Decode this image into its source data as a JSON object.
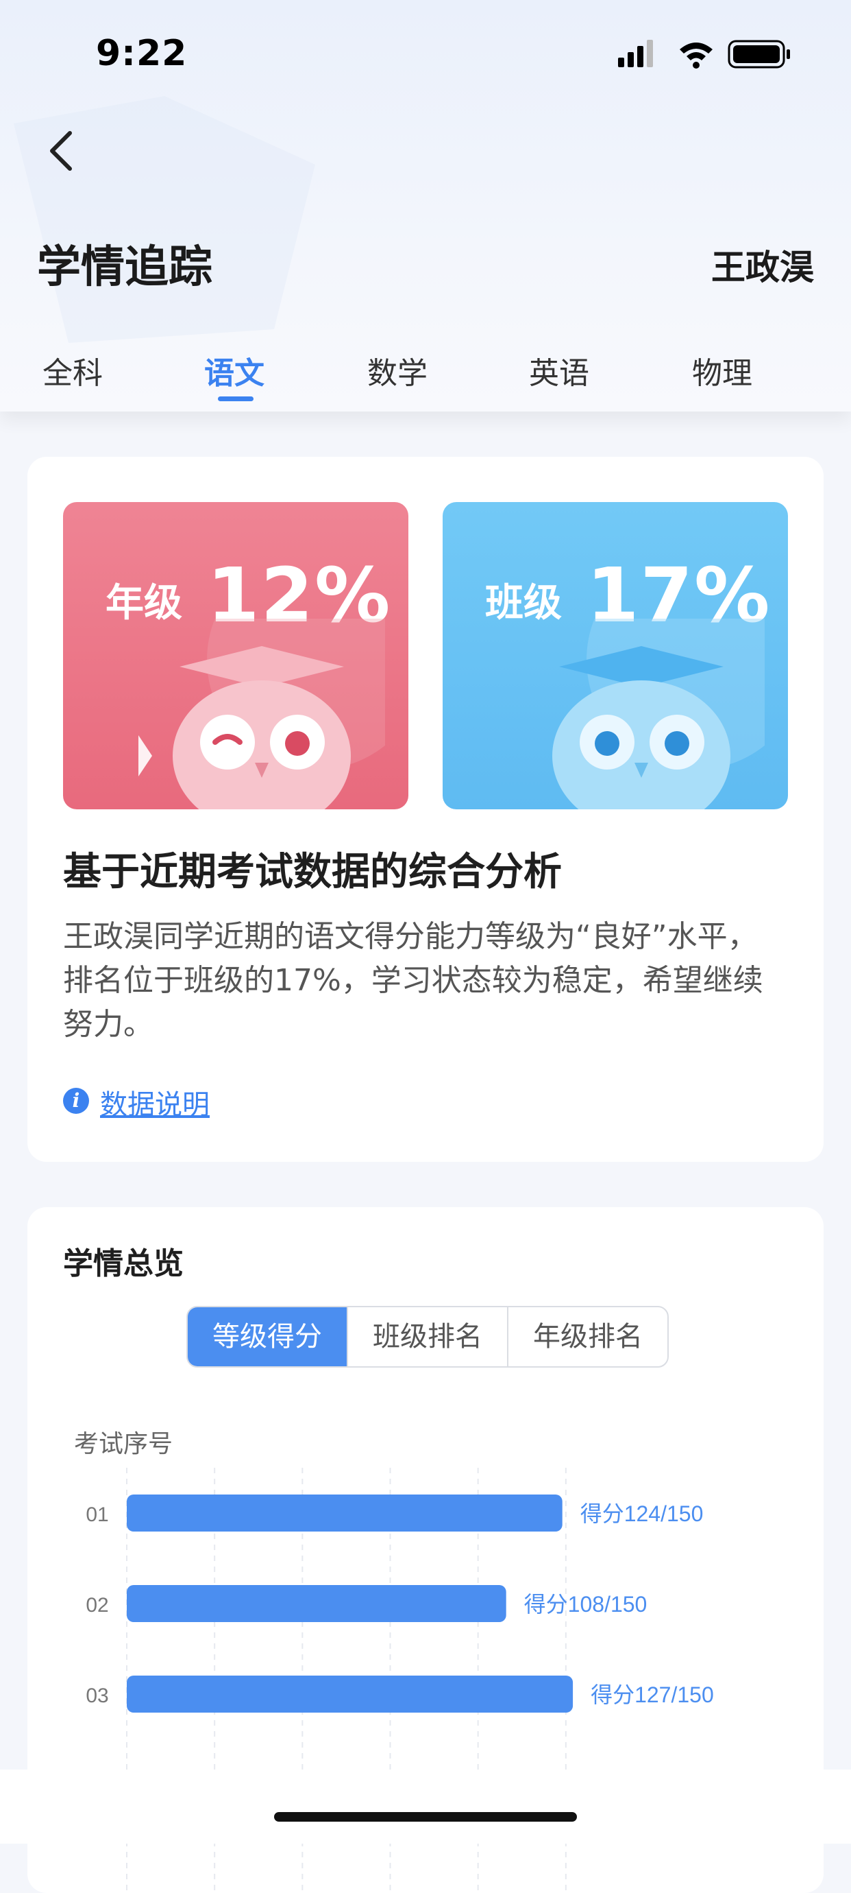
{
  "status_bar": {
    "time": "9:22"
  },
  "header": {
    "title": "学情追踪",
    "student_name": "王政淏"
  },
  "tabs": [
    {
      "label": "全科",
      "active": false
    },
    {
      "label": "语文",
      "active": true
    },
    {
      "label": "数学",
      "active": false
    },
    {
      "label": "英语",
      "active": false
    },
    {
      "label": "物理",
      "active": false
    }
  ],
  "summary": {
    "grade_rank": {
      "label": "年级",
      "value": "12%"
    },
    "class_rank": {
      "label": "班级",
      "value": "17%"
    },
    "analysis_title": "基于近期考试数据的综合分析",
    "analysis_text": "王政淏同学近期的语文得分能力等级为“良好”水平， 排名位于班级的17%，学习状态较为稳定，希望继续努力。",
    "info_link": "数据说明"
  },
  "overview": {
    "title": "学情总览",
    "segments": [
      "等级得分",
      "班级排名",
      "年级排名"
    ],
    "active_segment": 0,
    "y_axis_label": "考试序号"
  },
  "chart_data": {
    "type": "bar",
    "orientation": "horizontal",
    "categories": [
      "01",
      "02",
      "03"
    ],
    "values": [
      124,
      108,
      127
    ],
    "max": 150,
    "value_labels": [
      "得分124/150",
      "得分108/150",
      "得分127/150"
    ],
    "ylabel": "考试序号",
    "xlim": [
      0,
      150
    ],
    "grid": true,
    "color": "#4b8ef0"
  },
  "colors": {
    "accent": "#3b82f0",
    "grade_card": "#e86a7d",
    "class_card": "#5fbbf2"
  }
}
